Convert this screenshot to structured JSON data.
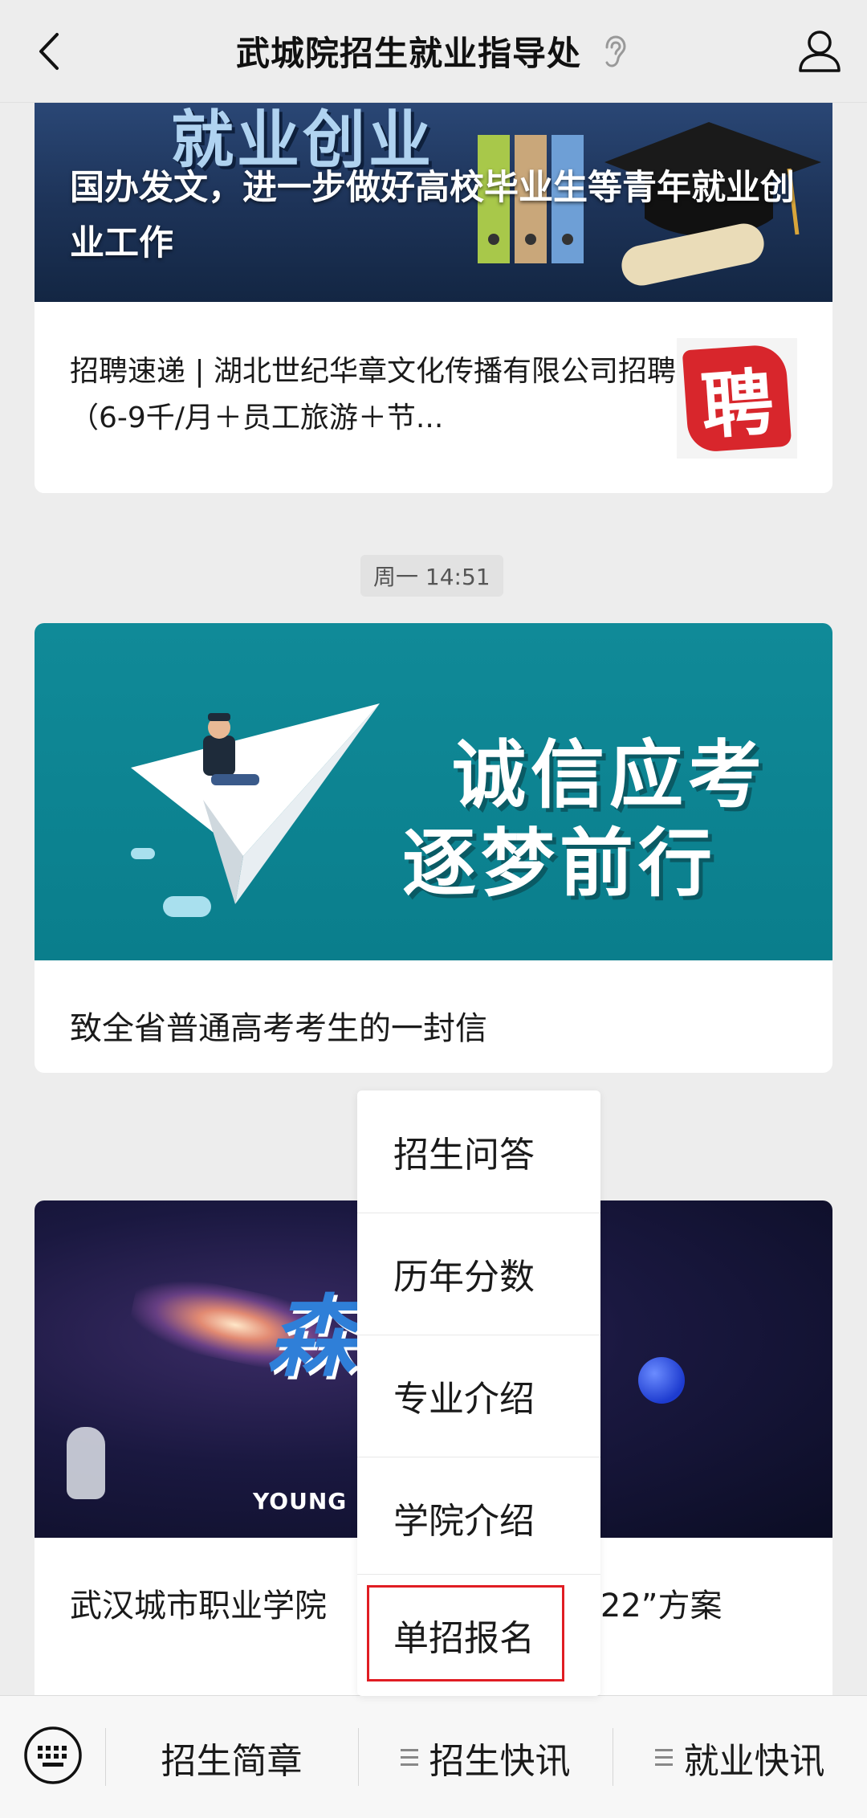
{
  "header": {
    "title": "武城院招生就业指导处"
  },
  "feed": {
    "card1": {
      "cover_text": "就业创业",
      "headline": "国办发文，进一步做好高校毕业生等青年就业创业工作",
      "sub_item": {
        "text": "招聘速递 | 湖北世纪华章文化传播有限公司招聘（6-9千/月＋员工旅游＋节...",
        "thumb_glyph": "聘"
      }
    },
    "timestamp": "周一 14:51",
    "card2": {
      "cover_line1": "诚信应考",
      "cover_line2": "逐梦前行",
      "caption": "致全省普通高考考生的一封信"
    },
    "card3": {
      "cover_text": "森",
      "cover_young": "YOUNG",
      "caption": "武汉城市职业学院",
      "caption_tail": "2022”方案"
    }
  },
  "popup_menu": {
    "items": [
      "招生问答",
      "历年分数",
      "专业介绍",
      "学院介绍",
      "单招报名"
    ],
    "highlighted_item": "单招报名",
    "highlight_color": "#e01d23"
  },
  "bottom_bar": {
    "tabs": [
      {
        "label": "招生简章",
        "has_submenu": false
      },
      {
        "label": "招生快讯",
        "has_submenu": true
      },
      {
        "label": "就业快讯",
        "has_submenu": true
      }
    ]
  },
  "colors": {
    "background": "#ededed",
    "card": "#ffffff",
    "accent_red": "#e01d23",
    "teal_cover": "#0a7e8c"
  }
}
